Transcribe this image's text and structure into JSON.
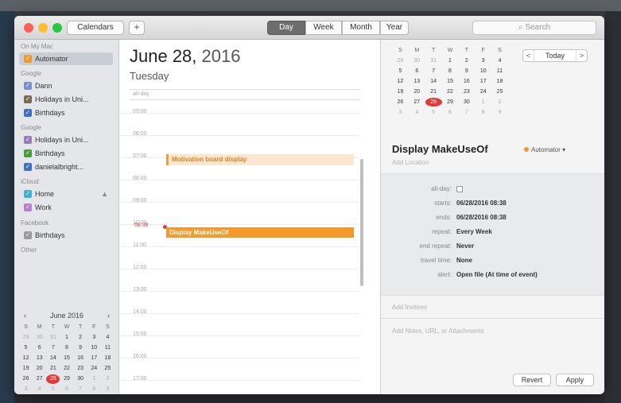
{
  "toolbar": {
    "calendars_label": "Calendars",
    "add_label": "+",
    "views": [
      "Day",
      "Week",
      "Month",
      "Year"
    ],
    "active_view": "Day",
    "search_placeholder": "Search"
  },
  "sidebar": {
    "sections": [
      {
        "title": "On My Mac",
        "items": [
          {
            "label": "Automator",
            "color": "#f39a2a",
            "selected": true
          }
        ]
      },
      {
        "title": "Google",
        "items": [
          {
            "label": "Dann",
            "color": "#7b8fc9"
          },
          {
            "label": "Holidays in Uni...",
            "color": "#7a6a56"
          },
          {
            "label": "Birthdays",
            "color": "#3f6fc4"
          }
        ]
      },
      {
        "title": "Google",
        "items": [
          {
            "label": "Holidays in Uni...",
            "color": "#9b7bbf"
          },
          {
            "label": "Birthdays",
            "color": "#4a9a3f"
          },
          {
            "label": "danielalbright...",
            "color": "#3f6fc4"
          }
        ]
      },
      {
        "title": "iCloud",
        "items": [
          {
            "label": "Home",
            "color": "#3fb0d8"
          },
          {
            "label": "Work",
            "color": "#b77fd1"
          }
        ]
      },
      {
        "title": "Facebook",
        "items": [
          {
            "label": "Birthdays",
            "color": "#9a9a9a"
          }
        ]
      },
      {
        "title": "Other",
        "items": []
      }
    ],
    "mini_calendar": {
      "month": "June 2016",
      "weekdays": [
        "S",
        "M",
        "T",
        "W",
        "T",
        "F",
        "S"
      ],
      "weeks": [
        [
          "29",
          "30",
          "31",
          "1",
          "2",
          "3",
          "4"
        ],
        [
          "5",
          "6",
          "7",
          "8",
          "9",
          "10",
          "11"
        ],
        [
          "12",
          "13",
          "14",
          "15",
          "16",
          "17",
          "18"
        ],
        [
          "19",
          "20",
          "21",
          "22",
          "23",
          "24",
          "25"
        ],
        [
          "26",
          "27",
          "28",
          "29",
          "30",
          "1",
          "2"
        ],
        [
          "3",
          "4",
          "5",
          "6",
          "7",
          "8",
          "9"
        ]
      ],
      "today": "28"
    }
  },
  "day_view": {
    "date_prefix": "June 28,",
    "year": "2016",
    "weekday": "Tuesday",
    "all_day_label": "all-day",
    "hours": [
      "05:00",
      "06:00",
      "07:00",
      "08:00",
      "09:00",
      "10:00",
      "11:00",
      "12:00",
      "13:00",
      "14:00",
      "15:00",
      "16:00",
      "17:00",
      "18:00"
    ],
    "now_label": "08:38",
    "events": [
      {
        "title": "Motivation board display"
      },
      {
        "title": "Display MakeUseOf"
      }
    ]
  },
  "right_pane": {
    "calendar": {
      "weekdays": [
        "S",
        "M",
        "T",
        "W",
        "T",
        "F",
        "S"
      ],
      "weeks": [
        [
          "29",
          "30",
          "31",
          "1",
          "2",
          "3",
          "4"
        ],
        [
          "5",
          "6",
          "7",
          "8",
          "9",
          "10",
          "11"
        ],
        [
          "12",
          "13",
          "14",
          "15",
          "16",
          "17",
          "18"
        ],
        [
          "19",
          "20",
          "21",
          "22",
          "23",
          "24",
          "25"
        ],
        [
          "26",
          "27",
          "28",
          "29",
          "30",
          "1",
          "2"
        ],
        [
          "3",
          "4",
          "5",
          "6",
          "7",
          "8",
          "9"
        ]
      ],
      "today": "28"
    },
    "nav": {
      "prev": "<",
      "today": "Today",
      "next": ">"
    },
    "event": {
      "title": "Display MakeUseOf",
      "calendar": "Automator",
      "calendar_color": "#f39a2a",
      "location_placeholder": "Add Location",
      "details": [
        {
          "label": "all-day:",
          "value": ""
        },
        {
          "label": "starts:",
          "value": "06/28/2016   08:38"
        },
        {
          "label": "ends:",
          "value": "06/28/2016   08:38"
        },
        {
          "label": "repeat:",
          "value": "Every Week"
        },
        {
          "label": "end repeat:",
          "value": "Never"
        },
        {
          "label": "travel time:",
          "value": "None"
        },
        {
          "label": "alert:",
          "value": "Open file (At time of event)"
        }
      ],
      "invitees_placeholder": "Add Invitees",
      "notes_placeholder": "Add Notes, URL, or Attachments"
    },
    "buttons": {
      "revert": "Revert",
      "apply": "Apply"
    }
  }
}
